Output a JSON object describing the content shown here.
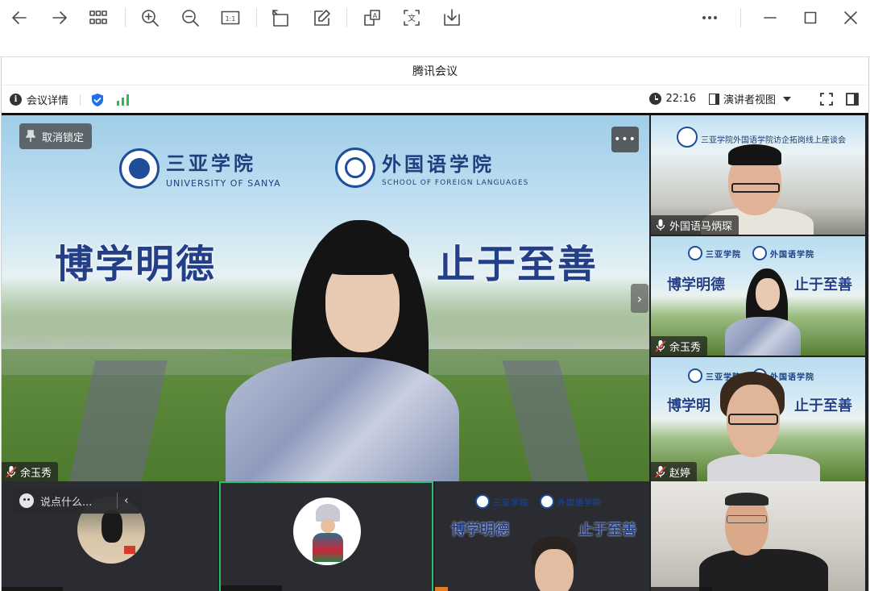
{
  "viewer_toolbar": {
    "icons": [
      "back-arrow-icon",
      "forward-arrow-icon",
      "grid-view-icon",
      "zoom-in-icon",
      "zoom-out-icon",
      "actual-size-icon",
      "rotate-icon",
      "edit-icon",
      "translate-icon",
      "ocr-text-icon",
      "download-icon",
      "more-icon",
      "minimize-icon",
      "maximize-icon",
      "close-icon"
    ],
    "actual_size_label": "1:1",
    "translate_label": "A",
    "ocr_label": "文"
  },
  "window": {
    "title": "腾讯会议"
  },
  "infobar": {
    "details_label": "会议详情",
    "info_glyph": "i",
    "time": "22:16",
    "view_label": "演讲者视图",
    "colors": {
      "shield": "#1e6fe8",
      "signal": "#2bbd4e"
    }
  },
  "main": {
    "unlock_label": "取消锁定",
    "more_label": "•••",
    "next_glyph": "›",
    "speaker_name": "余玉秀",
    "banner": {
      "university_cn": "三亚学院",
      "university_en": "UNIVERSITY OF SANYA",
      "school_cn": "外国语学院",
      "school_en": "SCHOOL OF FOREIGN LANGUAGES",
      "slogan_left": "博学明德",
      "slogan_right": "止于至善"
    }
  },
  "side": [
    {
      "name": "外国语马炳琛",
      "banner_text": "三亚学院外国语学院访企拓岗线上座谈会"
    },
    {
      "name": "余玉秀",
      "mini_left": "博学明德",
      "mini_right": "止于至善",
      "mini_uni": "三亚学院",
      "mini_school": "外国语学院"
    },
    {
      "name": "赵婷",
      "mini_left": "博学明",
      "mini_right": "止于至善",
      "mini_uni": "三亚学院",
      "mini_school": "外国语学院"
    }
  ],
  "bottom": {
    "chat_placeholder": "说点什么...",
    "chat_caret": "‹",
    "tiles": [
      {
        "mini_uni": "三亚学院",
        "mini_school": "外国语学院",
        "mini_left": "博学明德",
        "mini_right": "止于至善"
      }
    ]
  },
  "colors": {
    "active_border": "#2bbd6a",
    "brand_blue": "#1e4d9a"
  }
}
